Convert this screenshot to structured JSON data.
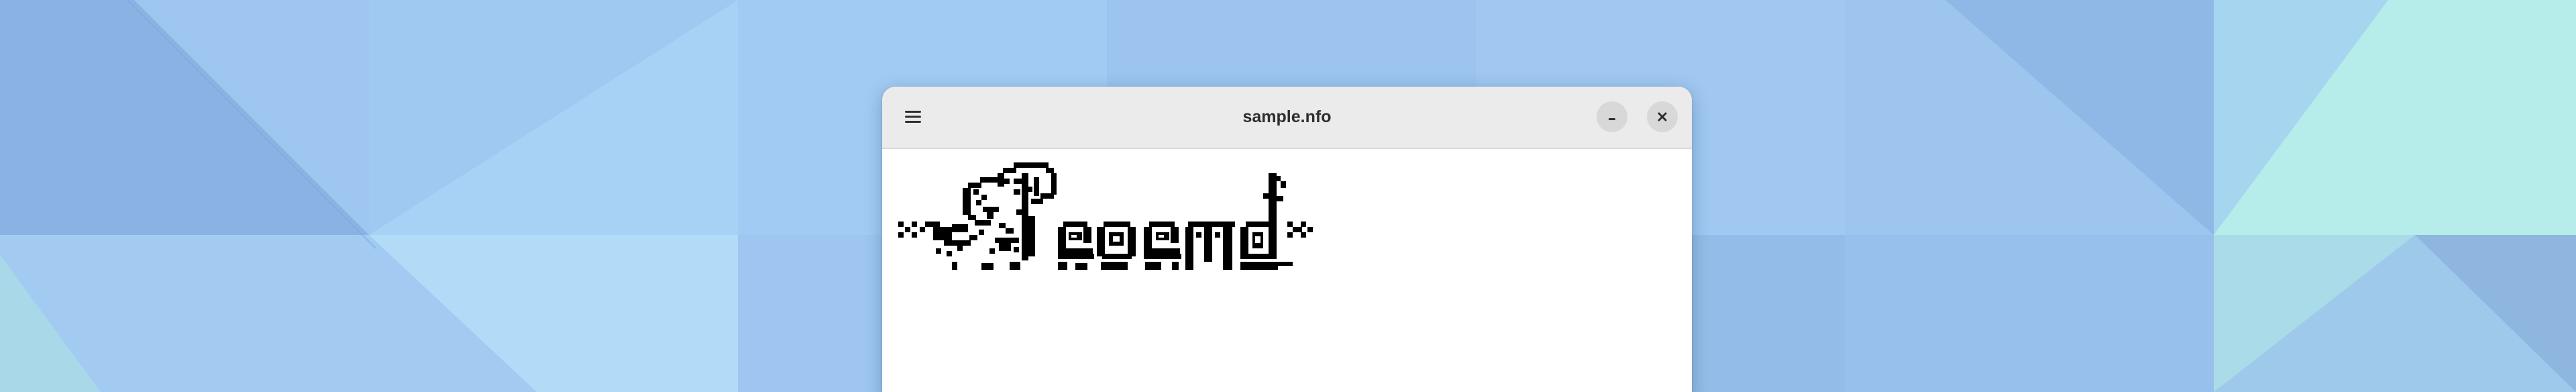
{
  "window": {
    "title": "sample.nfo"
  },
  "headerbar": {
    "menu_icon": "hamburger-menu-icon",
    "minimize_icon": "minimize-icon",
    "close_icon": "close-icon"
  },
  "document": {
    "art_description_icon": "nfo-ascii-art-logo"
  },
  "colors": {
    "headerbar": "#ebebeb",
    "window_button": "#d8d8d8",
    "art_ink": "#000000",
    "desktop_blue": "#9cc4ef"
  }
}
